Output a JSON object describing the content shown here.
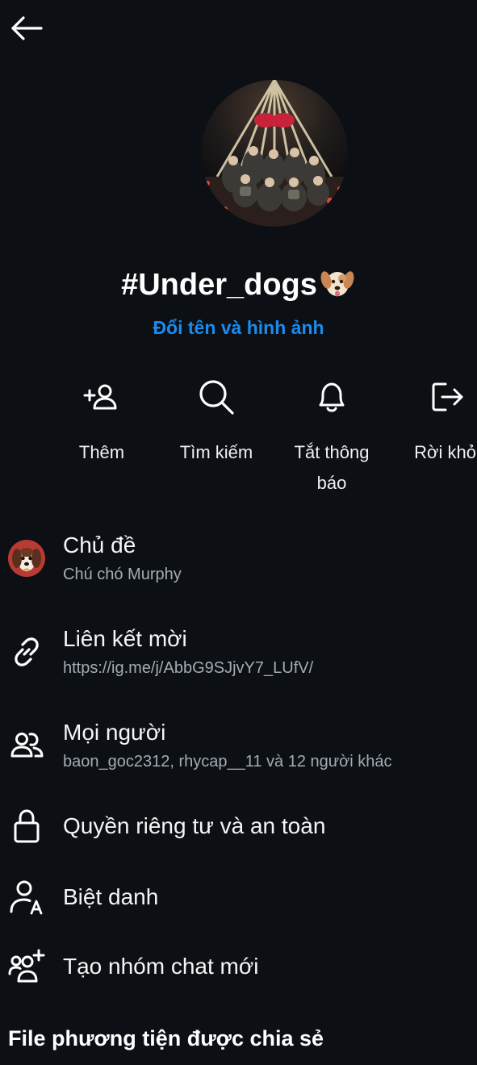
{
  "header": {
    "back_icon": "arrow-left-icon"
  },
  "group": {
    "name": "#Under_dogs",
    "name_emoji": "dog-face-emoji",
    "rename_label": "Đổi tên và hình ảnh",
    "accent_color": "#1a8cf0"
  },
  "actions": [
    {
      "label": "Thêm",
      "icon": "add-person-icon"
    },
    {
      "label": "Tìm kiếm",
      "icon": "search-icon"
    },
    {
      "label_line1": "Tắt thông",
      "label_line2": "báo",
      "icon": "bell-icon"
    },
    {
      "label": "Rời khỏi",
      "icon": "leave-icon"
    }
  ],
  "menu": {
    "theme": {
      "title": "Chủ đề",
      "subtitle": "Chú chó Murphy",
      "icon": "dog-theme-icon"
    },
    "invite_link": {
      "title": "Liên kết mời",
      "subtitle": "https://ig.me/j/AbbG9SJjvY7_LUfV/",
      "icon": "link-icon"
    },
    "people": {
      "title": "Mọi người",
      "subtitle": "baon_goc2312, rhycap__11 và 12 người khác",
      "icon": "people-icon"
    },
    "privacy": {
      "title": "Quyền riêng tư và an toàn",
      "icon": "lock-icon"
    },
    "nicknames": {
      "title": "Biệt danh",
      "icon": "nickname-icon"
    },
    "new_group": {
      "title": "Tạo nhóm chat mới",
      "icon": "create-group-icon"
    }
  },
  "shared_media": {
    "heading": "File phương tiện được chia sẻ"
  }
}
